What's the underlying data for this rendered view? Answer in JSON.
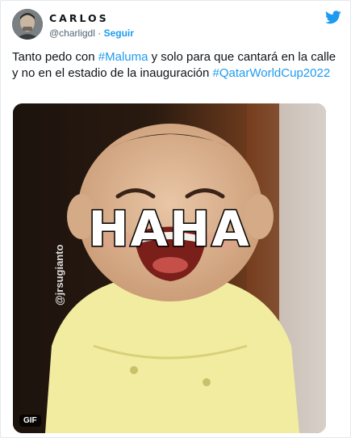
{
  "author": {
    "display_name": "CARLOS",
    "handle": "@charligdl",
    "separator": "·",
    "follow_label": "Seguir"
  },
  "tweet": {
    "text_part1": "Tanto pedo con ",
    "hashtag1": "#Maluma",
    "text_part2": " y solo para que cantará en la calle y no en el estadio de la inauguración ",
    "hashtag2": "#QatarWorldCup2022"
  },
  "media": {
    "caption": "HAHA",
    "watermark": "@jrsugianto",
    "gif_badge": "GIF"
  },
  "colors": {
    "link": "#1d9bf0",
    "text": "#0f1419",
    "muted": "#536471"
  },
  "icons": {
    "brand": "twitter-bird-icon"
  }
}
